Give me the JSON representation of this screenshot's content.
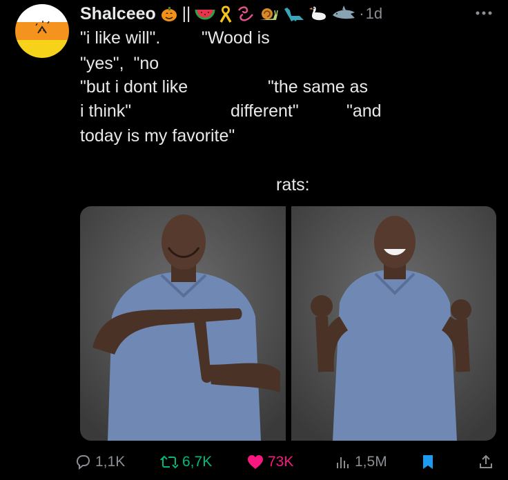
{
  "post": {
    "author": {
      "display_name": "Shalceeo",
      "name_separator": "||",
      "name_emojis": [
        "pumpkin-icon",
        "watermelon-icon",
        "ribbon-icon",
        "curl-icon",
        "snail-icon",
        "dinosaur-icon",
        "goose-icon",
        "shark-icon"
      ],
      "dot": "·",
      "timestamp": "1d"
    },
    "text": {
      "line1a": "\"i like will\".",
      "line1b": "\"Wood is",
      "line2": "\"yes\",  \"no",
      "line3a": "\"but i dont like",
      "line3b": "\"the same as",
      "line4a": "i think\"",
      "line4b": "different\"",
      "line4c": "\"and",
      "line5": "today is my favorite\""
    },
    "media_caption": "rats:",
    "media": [
      {
        "name": "shaq-refuse-photo"
      },
      {
        "name": "shaq-excited-photo"
      }
    ],
    "actions": {
      "replies": "1,1K",
      "reposts": "6,7K",
      "likes": "73K",
      "views": "1,5M"
    }
  },
  "colors": {
    "background": "#000000",
    "text": "#e7e9ea",
    "secondary": "#8b8f94",
    "repost": "#00ba7c",
    "like": "#f91880",
    "bookmark": "#1d9bf0"
  }
}
